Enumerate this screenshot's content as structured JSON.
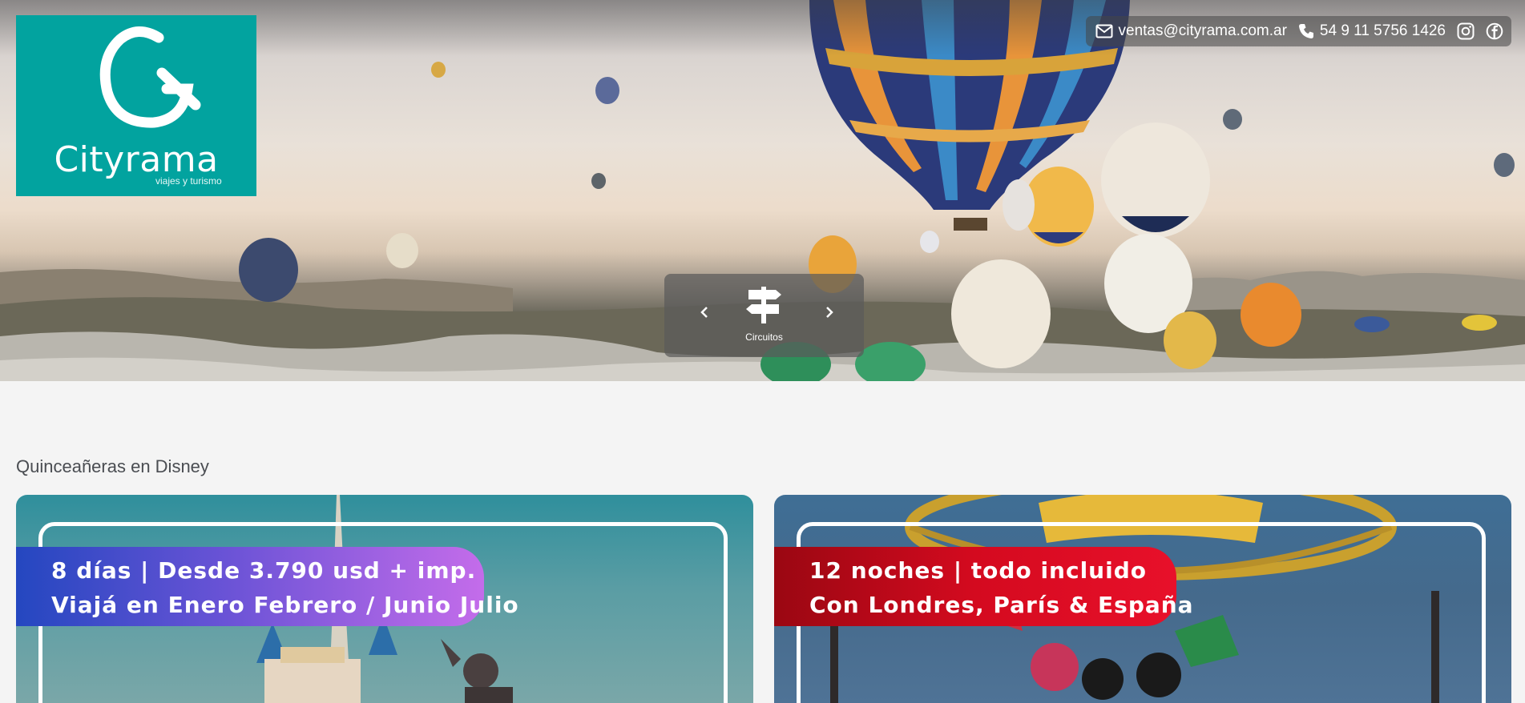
{
  "brand": {
    "name": "Cityrama",
    "tagline": "viajes y turismo",
    "color": "#02a39f"
  },
  "contact": {
    "email": "ventas@cityrama.com.ar",
    "phone": "54 9 11 5756 1426",
    "icons": [
      "mail-icon",
      "phone-icon",
      "instagram-icon",
      "facebook-icon"
    ]
  },
  "category_slider": {
    "current": "Circuitos",
    "icon": "signpost-icon"
  },
  "section": {
    "title": "Quinceañeras en Disney"
  },
  "cards": [
    {
      "line1": "8 días | Desde 3.790 usd + imp.",
      "line2": "Viajá en Enero Febrero / Junio Julio"
    },
    {
      "line1": "12 noches | todo incluido",
      "line2": "Con Londres, París & España"
    }
  ]
}
